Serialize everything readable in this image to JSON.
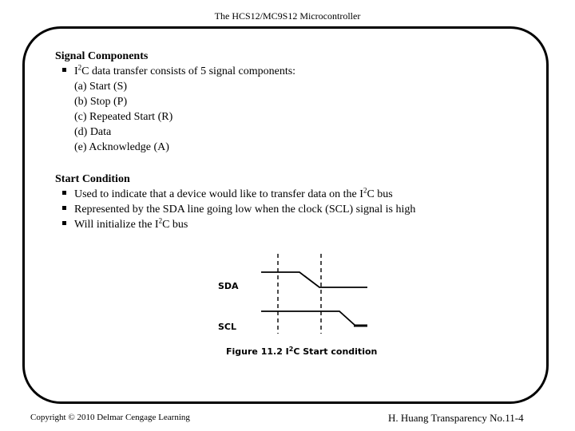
{
  "header": {
    "title": "The HCS12/MC9S12 Microcontroller"
  },
  "sections": [
    {
      "heading": "Signal Components",
      "bullets": [
        "I2C data transfer consists of 5 signal components:"
      ],
      "subitems": [
        "(a) Start (S)",
        "(b) Stop (P)",
        "(c) Repeated Start (R)",
        "(d) Data",
        "(e) Acknowledge (A)"
      ]
    },
    {
      "heading": "Start Condition",
      "bullets": [
        "Used to indicate that a device would like to transfer data on the I2C bus",
        "Represented by the SDA line going low when the clock (SCL) signal is high",
        "Will initialize the I2C bus"
      ],
      "subitems": []
    }
  ],
  "bullet_prefix_sup": "2",
  "figure": {
    "caption": "Figure 11.2 I2C Start condition",
    "caption_pre": "Figure 11.2 I",
    "caption_sup": "2",
    "caption_post": "C Start condition",
    "signals": [
      {
        "name": "SDA",
        "label": "SDA"
      },
      {
        "name": "SCL",
        "label": "SCL"
      }
    ]
  },
  "footer": {
    "copyright": "Copyright © 2010 Delmar Cengage Learning",
    "attribution": "H. Huang Transparency No.11-4"
  },
  "colors": {
    "ink": "#000000",
    "background": "#ffffff"
  }
}
